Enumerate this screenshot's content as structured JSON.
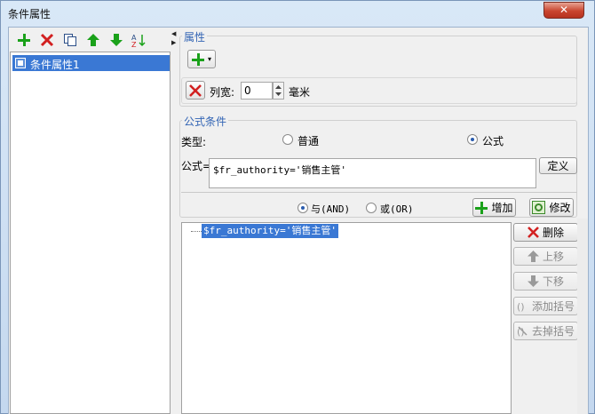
{
  "window": {
    "title": "条件属性",
    "close_label": "✕"
  },
  "left_toolbar": {
    "icons": [
      "add-icon",
      "delete-icon",
      "copy-icon",
      "move-up-icon",
      "move-down-icon",
      "sort-icon"
    ]
  },
  "left_list": {
    "items": [
      {
        "label": "条件属性1"
      }
    ]
  },
  "attributes": {
    "legend": "属性",
    "add_menu_label": "▾",
    "row": {
      "label": "列宽:",
      "value": "0",
      "unit": "毫米"
    }
  },
  "formula_condition": {
    "legend": "公式条件",
    "type_label": "类型:",
    "option_normal": "普通",
    "option_formula": "公式",
    "selected": "公式",
    "formula_label": "公式=",
    "formula_value": "$fr_authority='销售主管'",
    "define_button": "定义"
  },
  "logic": {
    "and_label": "与(AND)",
    "or_label": "或(OR)",
    "selected": "与(AND)",
    "add_button": "增加",
    "modify_button": "修改"
  },
  "condition_list": {
    "items": [
      {
        "label": "$fr_authority='销售主管'"
      }
    ]
  },
  "side_buttons": {
    "delete": "删除",
    "move_up": "上移",
    "move_down": "下移",
    "add_bracket": "添加括号",
    "remove_bracket": "去掉括号"
  },
  "colors": {
    "selection": "#3a78d4",
    "legend": "#3264b4",
    "green": "#1aa11a",
    "red": "#d22020"
  }
}
